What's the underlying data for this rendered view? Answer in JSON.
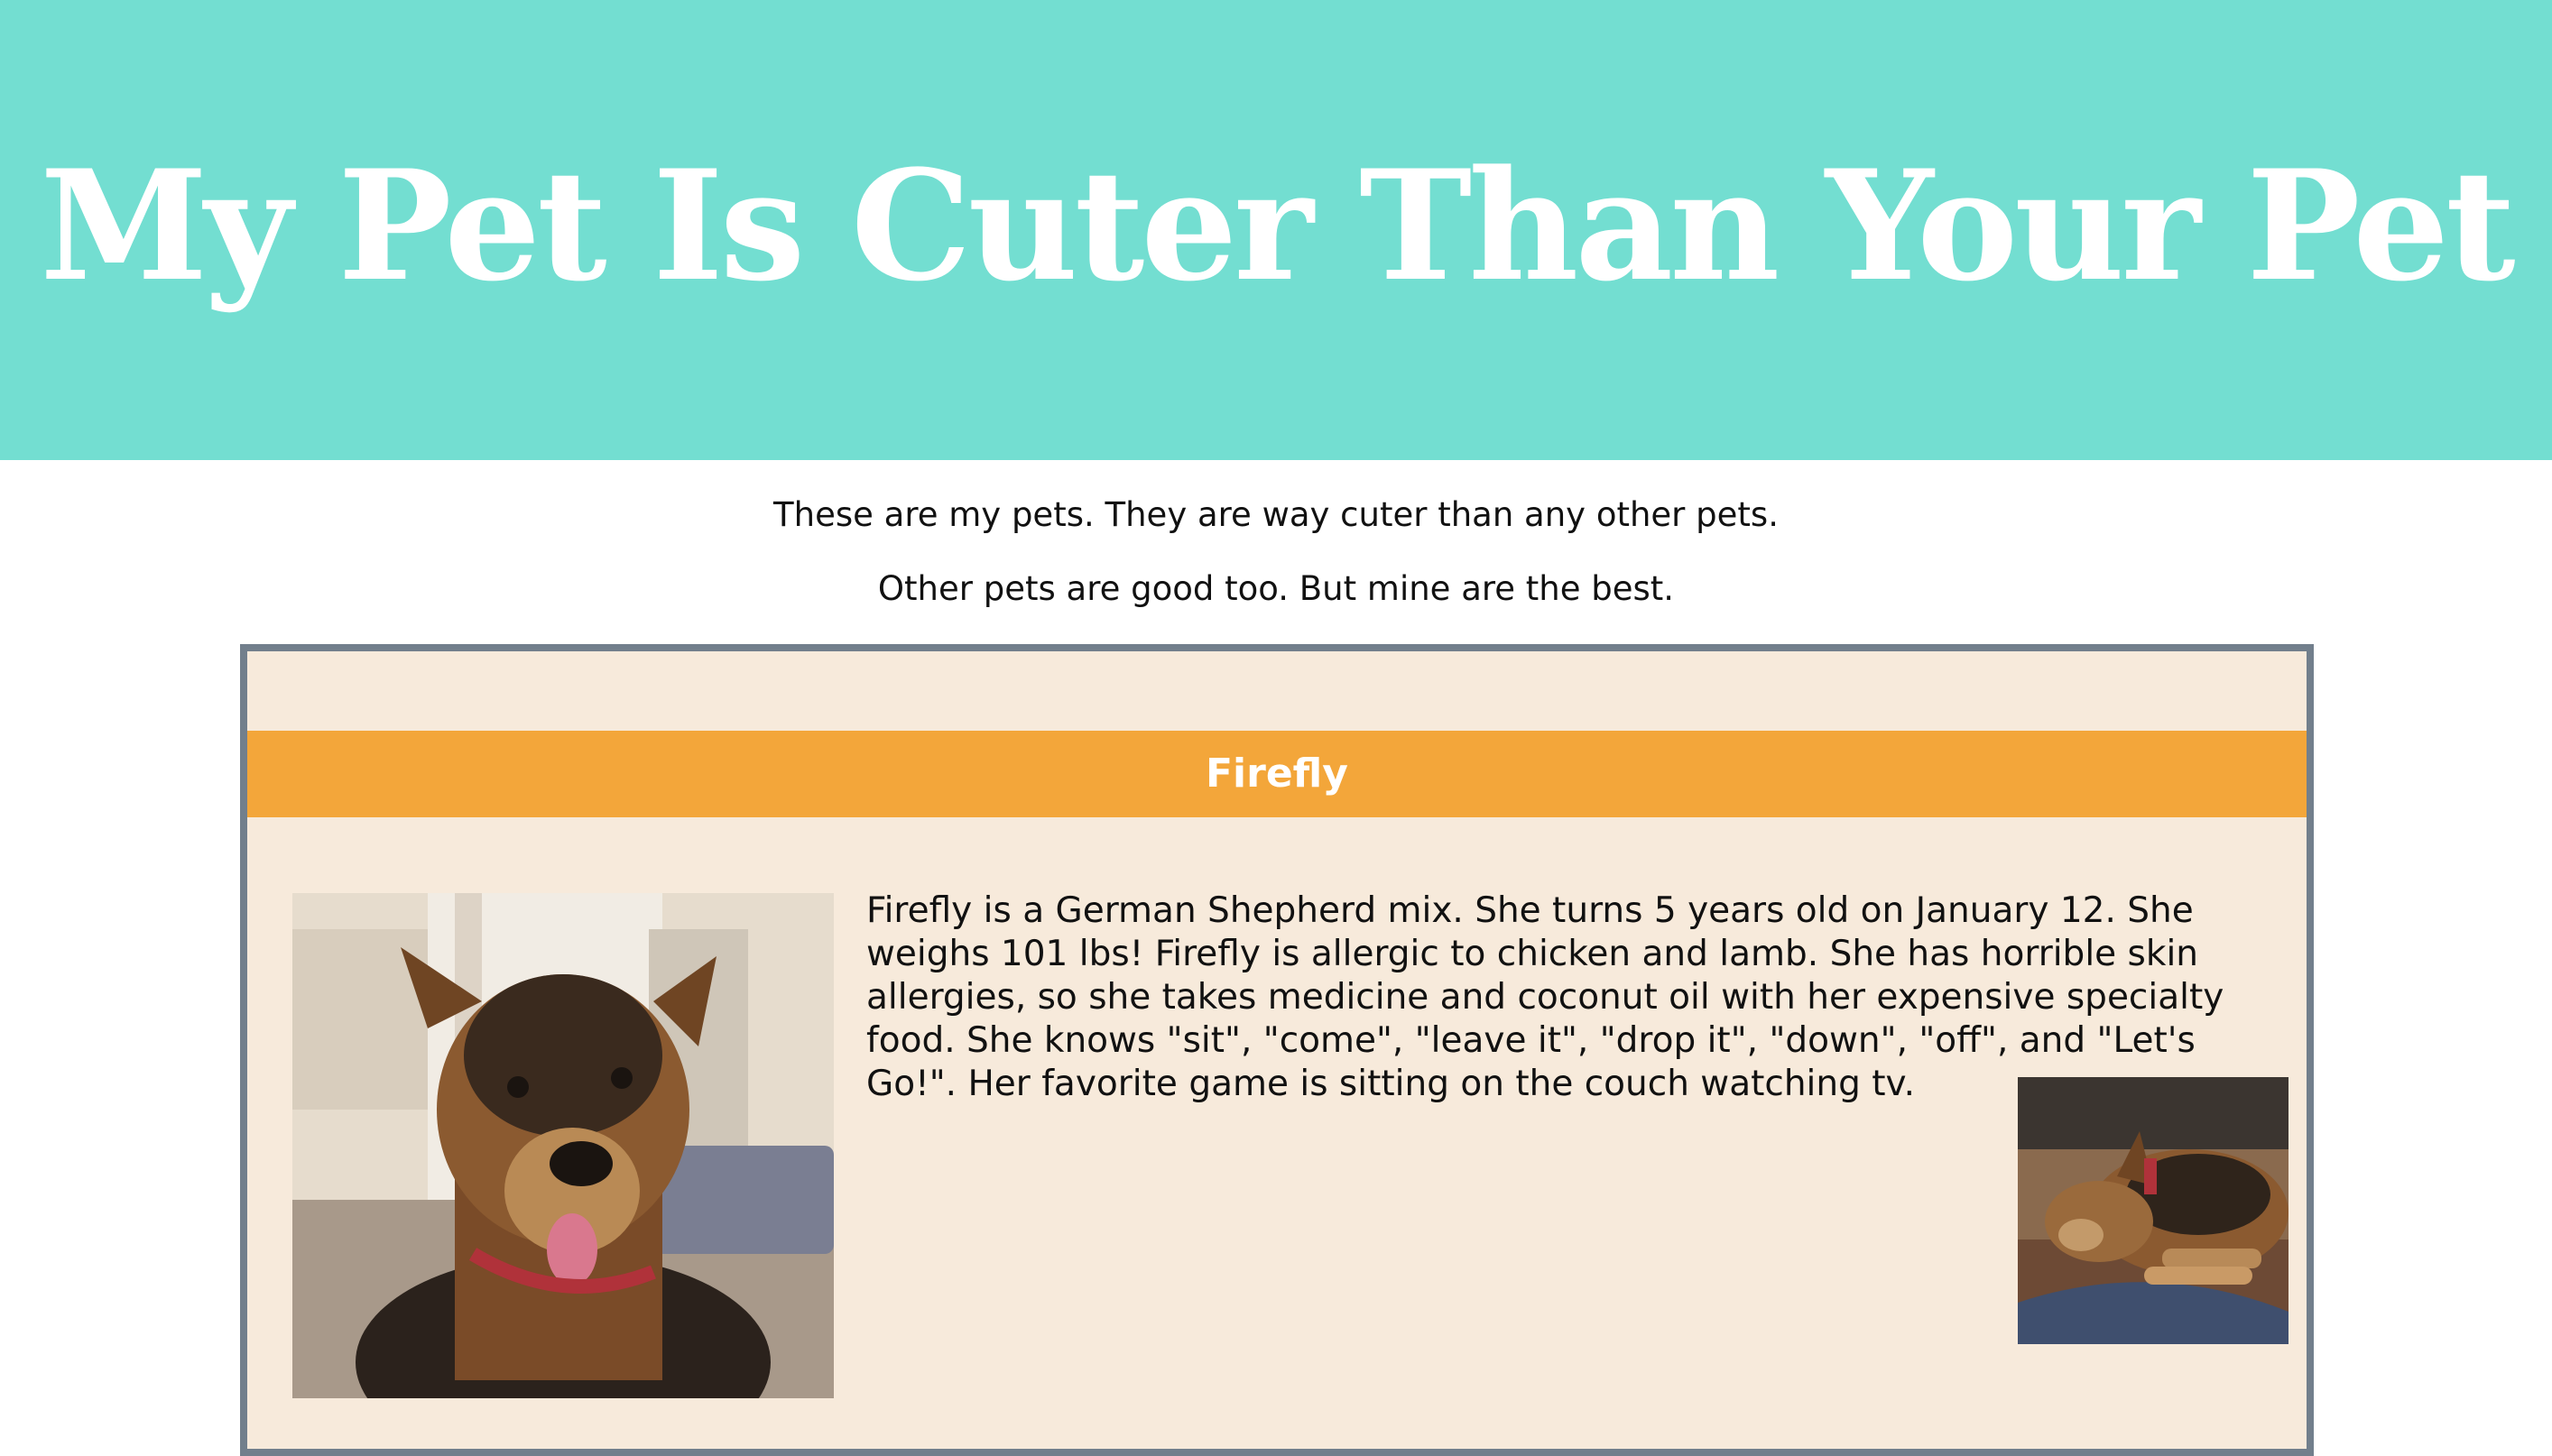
{
  "header": {
    "title": "My Pet Is Cuter Than Your Pet"
  },
  "intro": {
    "line1": "These are my pets. They are way cuter than any other pets.",
    "line2": "Other pets are good too. But mine are the best."
  },
  "pets": [
    {
      "name": "Firefly",
      "description": "Firefly is a German Shepherd mix. She turns 5 years old on January 12. She weighs 101 lbs! Firefly is allergic to chicken and lamb. She has horrible skin allergies, so she takes medicine and coconut oil with her expensive specialty food. She knows \"sit\", \"come\", \"leave it\", \"drop it\", \"down\", \"off\", and \"Let's Go!\". Her favorite game is sitting on the couch watching tv.",
      "photo_main": "dog-portrait-photo",
      "photo_small": "dog-sleeping-photo"
    }
  ],
  "colors": {
    "header_bg": "#73ded1",
    "card_bg": "#f7eadb",
    "card_border": "#727f8c",
    "name_bar": "#f3a63a",
    "title_text": "#ffffff"
  }
}
